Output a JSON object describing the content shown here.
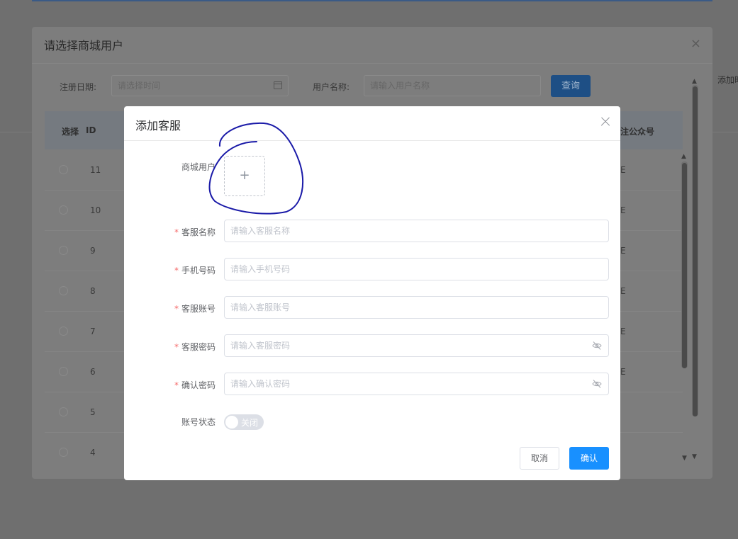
{
  "background": {
    "ghost_text": "添加时"
  },
  "outer_dialog": {
    "title": "请选择商城用户",
    "close_glyph": "×",
    "filters": {
      "date_label": "注册日期:",
      "date_placeholder": "请选择时间",
      "username_label": "用户名称:",
      "username_placeholder": "请输入用户名称",
      "query_button": "查询"
    },
    "table": {
      "headers": {
        "select": "选择",
        "id": "ID",
        "follow": "注公众号"
      },
      "rows": [
        {
          "id": "11",
          "tail": "E"
        },
        {
          "id": "10",
          "tail": "E"
        },
        {
          "id": "9",
          "tail": "E"
        },
        {
          "id": "8",
          "tail": "E"
        },
        {
          "id": "7",
          "tail": "E"
        },
        {
          "id": "6",
          "tail": "E"
        },
        {
          "id": "5",
          "tail": ""
        },
        {
          "id": "4",
          "tail": ""
        }
      ]
    }
  },
  "modal": {
    "title": "添加客服",
    "fields": {
      "mall_user_label": "商城用户",
      "upload_plus": "+",
      "service_name_label": "客服名称",
      "service_name_placeholder": "请输入客服名称",
      "phone_label": "手机号码",
      "phone_placeholder": "请输入手机号码",
      "account_label": "客服账号",
      "account_placeholder": "请输入客服账号",
      "password_label": "客服密码",
      "password_placeholder": "请输入客服密码",
      "confirm_label": "确认密码",
      "confirm_placeholder": "请输入确认密码",
      "status_label": "账号状态",
      "status_value": "关闭"
    },
    "required_mark": "*",
    "cancel_button": "取消",
    "confirm_button": "确认"
  },
  "colors": {
    "primary": "#1890ff",
    "required": "#f56c6c",
    "annotation_ink": "#1a1aa8"
  }
}
